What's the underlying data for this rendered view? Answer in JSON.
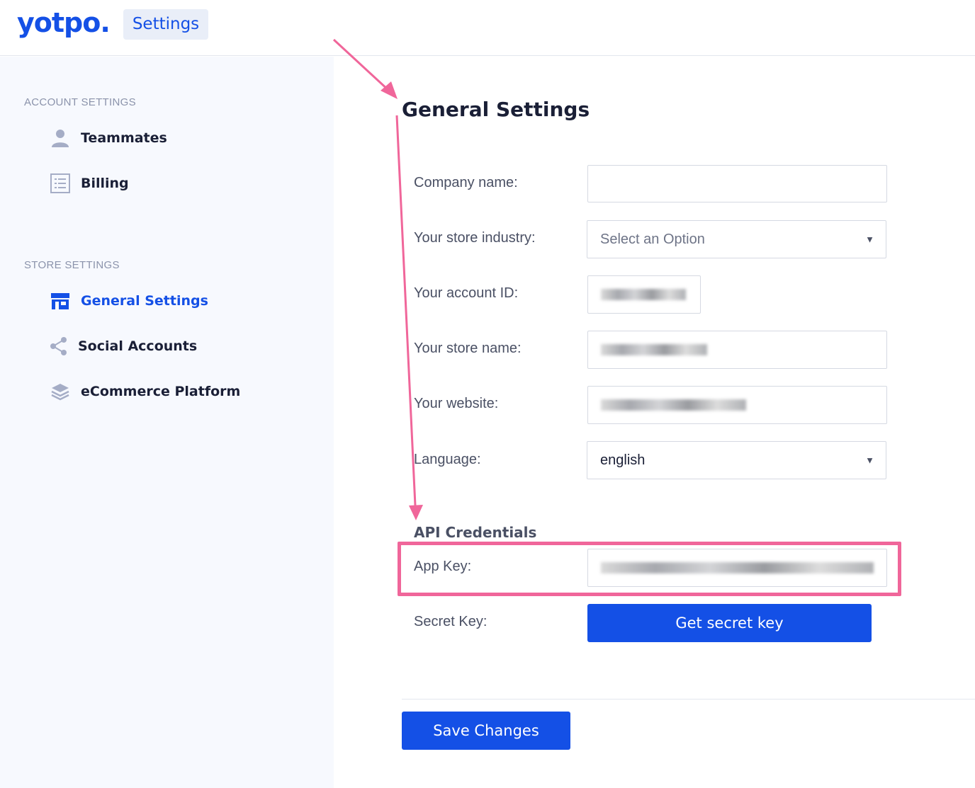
{
  "header": {
    "logo": "yotpo.",
    "section_chip": "Settings"
  },
  "sidebar": {
    "account_section": "ACCOUNT SETTINGS",
    "account_items": [
      {
        "label": "Teammates",
        "icon": "person-icon"
      },
      {
        "label": "Billing",
        "icon": "invoice-icon"
      }
    ],
    "store_section": "STORE SETTINGS",
    "store_items": [
      {
        "label": "General Settings",
        "icon": "storefront-icon",
        "active": true
      },
      {
        "label": "Social Accounts",
        "icon": "share-icon"
      },
      {
        "label": "eCommerce Platform",
        "icon": "layers-icon"
      }
    ]
  },
  "main": {
    "title": "General Settings",
    "fields": {
      "company_name": {
        "label": "Company name:",
        "value": ""
      },
      "store_industry": {
        "label": "Your store industry:",
        "value": "Select an Option"
      },
      "account_id": {
        "label": "Your account ID:"
      },
      "store_name": {
        "label": "Your store name:"
      },
      "website": {
        "label": "Your website:"
      },
      "language": {
        "label": "Language:",
        "value": "english"
      }
    },
    "api": {
      "title": "API Credentials",
      "app_key_label": "App Key:",
      "secret_key_label": "Secret Key:",
      "get_secret_button": "Get secret key"
    },
    "save_button": "Save Changes"
  },
  "colors": {
    "brand_blue": "#1450e6",
    "annotation_pink": "#f0669a",
    "sidebar_bg": "#f7f9fe"
  }
}
